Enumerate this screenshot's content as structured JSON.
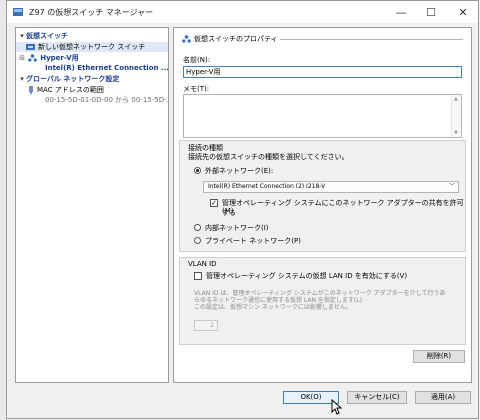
{
  "window": {
    "title": "Z97 の仮想スイッチ マネージャー",
    "controls": {
      "minimize": "—",
      "maximize": "☐",
      "close": "✕"
    }
  },
  "sidebar": {
    "virtual_switches_header": "仮想スイッチ",
    "new_switch": "新しい仮想ネットワーク スイッチ",
    "switch_name": "Hyper-V用",
    "switch_adapter": "Intel(R) Ethernet Connection ...",
    "global_header": "グローバル ネットワーク設定",
    "mac_range_label": "MAC アドレスの範囲",
    "mac_range_value": "00-15-5D-01-0D-00 から 00-15-5D-..."
  },
  "properties": {
    "section_title": "仮想スイッチのプロパティ",
    "name_label": "名前(N):",
    "name_value": "Hyper-V用",
    "notes_label": "メモ(T):",
    "connection_type_title": "接続の種類",
    "connection_type_prompt": "接続先の仮想スイッチの種類を選択してください。",
    "external_label": "外部ネットワーク(E):",
    "adapter_selected": "Intel(R) Ethernet Connection (2) I218-V",
    "allow_mgmt_os_line1": "管理オペレーティング システムにこのネットワーク アダプターの共有を許可する",
    "allow_mgmt_os_line2": "(M)",
    "internal_label": "内部ネットワーク(I)",
    "private_label": "プライベート ネットワーク(P)",
    "vlan_title": "VLAN ID",
    "vlan_enable_label": "管理オペレーティング システムの仮想 LAN ID を有効にする(V)",
    "vlan_desc_line1": "VLAN ID は、管理オペレーティング システムがこのネットワーク アダプターを介して行うあ",
    "vlan_desc_line2": "らゆるネットワーク通信に使用する仮想 LAN を指定します(L)",
    "vlan_desc_line3": "この設定は、仮想マシン ネットワークには影響しません。",
    "vlan_value": "2",
    "remove_button": "削除(R)"
  },
  "footer": {
    "ok": "OK(O)",
    "cancel": "キャンセル(C)",
    "apply": "適用(A)"
  },
  "selection": {
    "connection_type": "external",
    "allow_mgmt_os_checked": true,
    "vlan_enabled": false
  },
  "colors": {
    "section_header": "#1a3e8c",
    "selected_row": "#dfe8f6",
    "input_focus_border": "#4a7cc0"
  }
}
